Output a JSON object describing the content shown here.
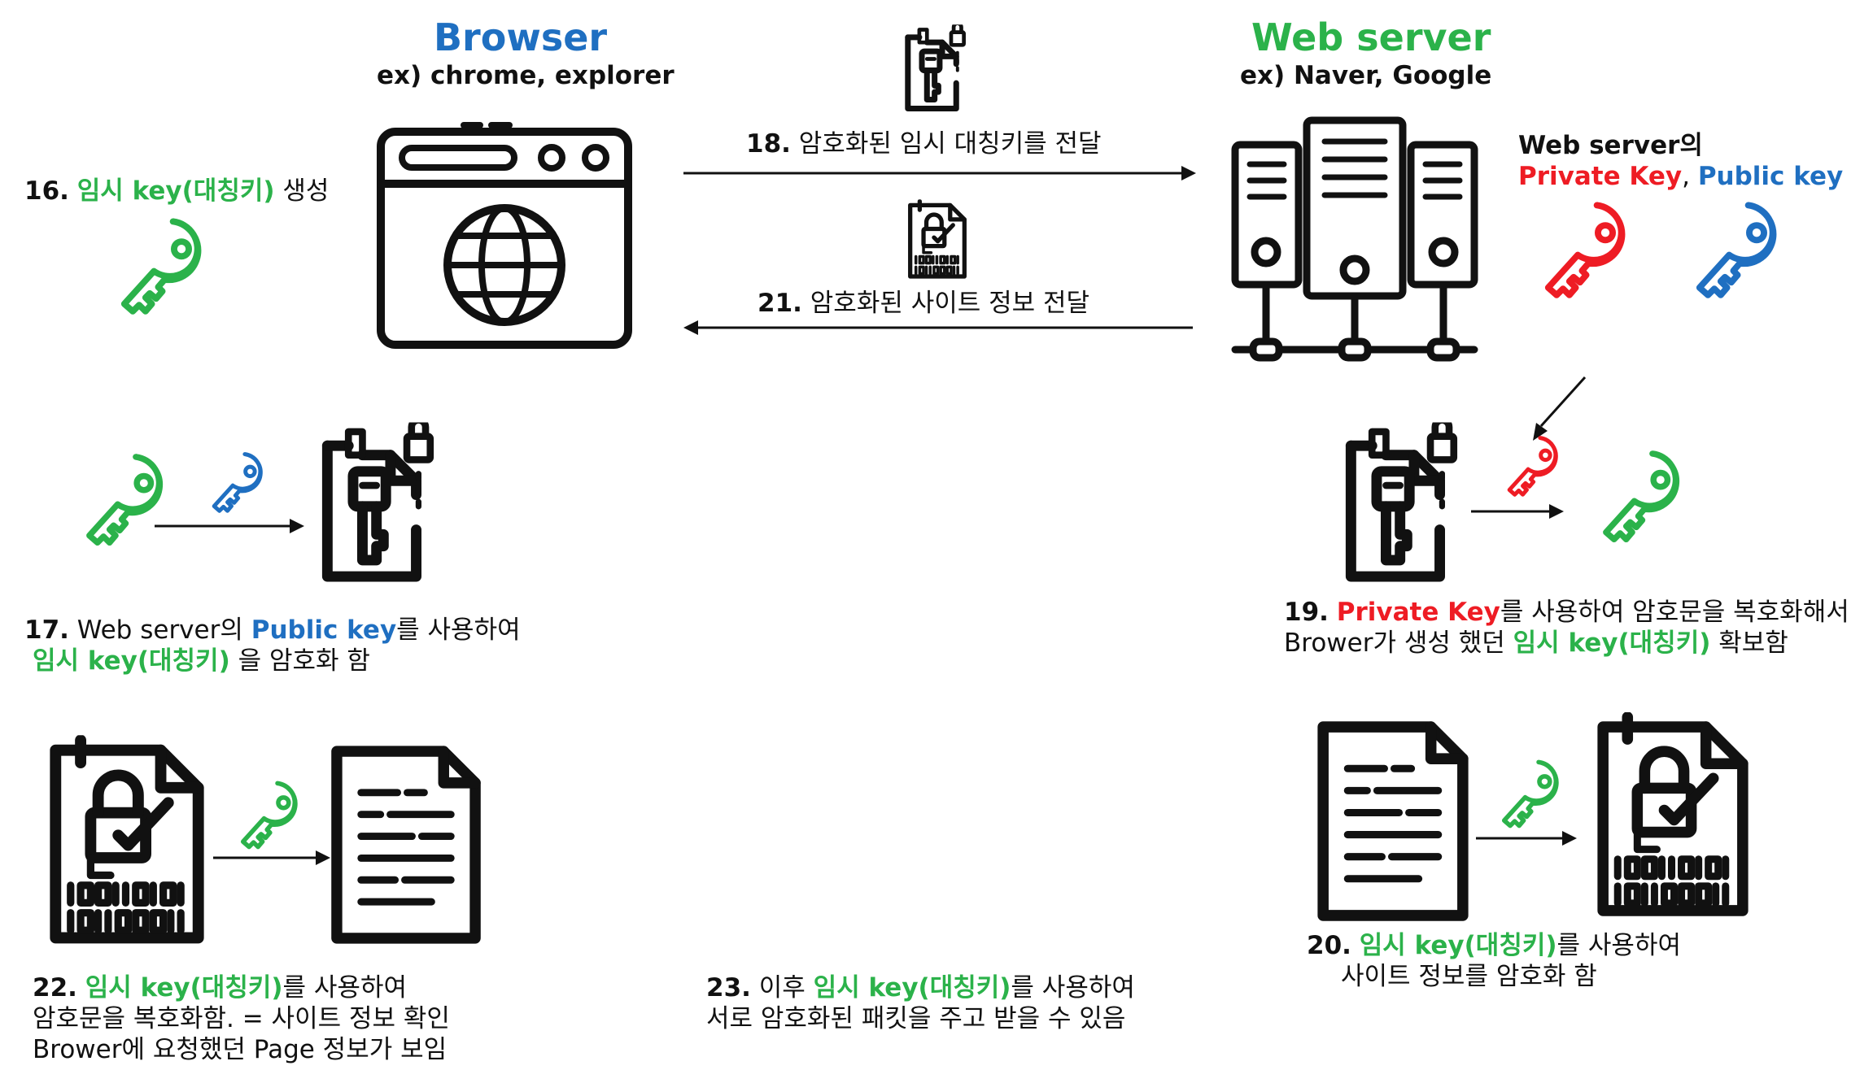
{
  "browser": {
    "title": "Browser",
    "subtitle": "ex) chrome, explorer"
  },
  "server": {
    "title": "Web server",
    "subtitle": "ex) Naver, Google"
  },
  "colors": {
    "browser_blue": "#1f6fc1",
    "server_green": "#2bb24a",
    "key_green": "#2bb24a",
    "key_blue": "#1f6fc1",
    "key_red": "#ee1c24"
  },
  "step16": {
    "num": "16.",
    "highlight": "임시 key(대칭키)",
    "rest": " 생성"
  },
  "step17": {
    "num": "17.",
    "pre": " Web server의 ",
    "highlight_blue": "Public key",
    "post": "를 사용하여",
    "line2_highlight": "임시 key(대칭키)",
    "line2_rest": " 을 암호화 함"
  },
  "step18": {
    "num": "18.",
    "text": " 암호화된 임시 대칭키를 전달"
  },
  "step19": {
    "num": "19.",
    "highlight_red": "Private Key",
    "post": "를 사용하여 암호문을 복호화해서",
    "line2_pre": "Brower가 생성 했던 ",
    "line2_highlight": "임시 key(대칭키)",
    "line2_rest": " 확보함"
  },
  "step20": {
    "num": "20.",
    "highlight": "임시 key(대칭키)",
    "post": "를 사용하여",
    "line2": "사이트 정보를 암호화 함"
  },
  "step21": {
    "num": "21.",
    "text": " 암호화된 사이트 정보 전달"
  },
  "step22": {
    "num": "22.",
    "highlight": "임시 key(대칭키)",
    "post": "를 사용하여",
    "line2": "암호문을 복호화함. = 사이트 정보 확인",
    "line3": "Brower에 요청했던 Page 정보가 보임"
  },
  "step23": {
    "num": "23.",
    "pre": " 이후 ",
    "highlight": "임시 key(대칭키)",
    "post": "를 사용하여",
    "line2": "서로 암호화된 패킷을 주고 받을 수 있음"
  },
  "server_keys": {
    "label_line1": "Web server의",
    "private_label": "Private Key",
    "separator": ", ",
    "public_label": "Public key"
  },
  "icons": [
    "browser-window-icon",
    "server-icon",
    "key-icon",
    "locked-key-document-icon",
    "encrypted-document-icon",
    "text-document-icon",
    "arrow-icon"
  ]
}
